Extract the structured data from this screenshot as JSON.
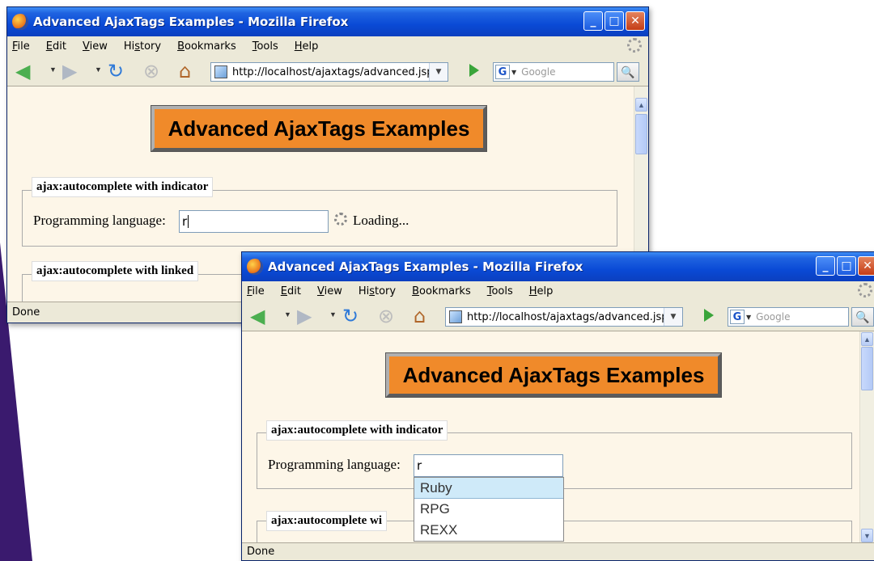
{
  "window_title": "Advanced AjaxTags Examples - Mozilla Firefox",
  "menu": [
    {
      "pre": "",
      "u": "F",
      "post": "ile"
    },
    {
      "pre": "",
      "u": "E",
      "post": "dit"
    },
    {
      "pre": "",
      "u": "V",
      "post": "iew"
    },
    {
      "pre": "Hi",
      "u": "s",
      "post": "tory"
    },
    {
      "pre": "",
      "u": "B",
      "post": "ookmarks"
    },
    {
      "pre": "",
      "u": "T",
      "post": "ools"
    },
    {
      "pre": "",
      "u": "H",
      "post": "elp"
    }
  ],
  "url": "http://localhost/ajaxtags/advanced.jsp",
  "search_placeholder": "Google",
  "page_heading": "Advanced AjaxTags Examples",
  "section1_legend": "ajax:autocomplete with indicator",
  "section2_legend_full": "ajax:autocomplete with linked",
  "section2_legend_truncated": "ajax:autocomplete wi",
  "field_label": "Programming language:",
  "input_value": "r",
  "loading_text": "Loading...",
  "suggestions": [
    "Ruby",
    "RPG",
    "REXX"
  ],
  "status_text": "Done",
  "colors": {
    "heading_bg": "#f08a2a",
    "page_bg": "#fdf6e8",
    "titlebar": "#0a4ad6",
    "accent": "#3a1a6e"
  }
}
